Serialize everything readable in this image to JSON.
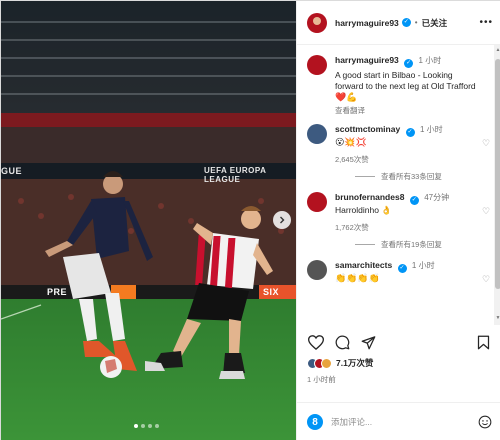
{
  "post": {
    "username": "harrymaguire93",
    "follow_status": "已关注",
    "more_icon": "more-options-icon",
    "caption": {
      "username": "harrymaguire93",
      "time": "1 小时",
      "text": "A good start in Bilbao - Looking forward to the next leg at Old Trafford",
      "emojis": "❤️💪",
      "translate": "查看翻译"
    },
    "comments": [
      {
        "username": "scottmctominay",
        "time": "1 小时",
        "text": "😮💥💢",
        "likes": "2,645次赞",
        "replies": "查看所有33条回复",
        "avatar_color": "#3d5a80"
      },
      {
        "username": "brunofernandes8",
        "time": "47分钟",
        "text": "Harroldinho 👌",
        "likes": "1,762次赞",
        "replies": "查看所有19条回复",
        "avatar_color": "#b3121f"
      },
      {
        "username": "samarchitects",
        "time": "1 小时",
        "text": "👏👏👏👏",
        "avatar_color": "#555555"
      }
    ],
    "likes_count": "7.1万次赞",
    "post_time": "1 小时前",
    "comment_placeholder": "添加评论...",
    "photo": {
      "banner_left": "UEFA EUROPA LEAGUE",
      "banner_partial_left": "GUE",
      "board_text_1": "PRE",
      "board_text_2": "SIX",
      "carousel_dots": 4,
      "active_dot": 1
    }
  },
  "colors": {
    "accent": "#0095f6",
    "text": "#262626",
    "muted": "#737373",
    "heart_red": "#ed4956"
  }
}
